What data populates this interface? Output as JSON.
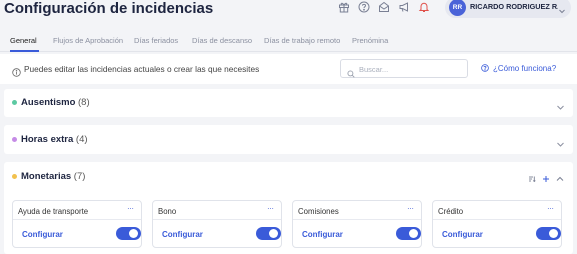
{
  "header": {
    "title": "Configuración de incidencias",
    "icons": [
      "gift-icon",
      "help-circle-icon",
      "mail-icon",
      "megaphone-icon",
      "bell-icon"
    ],
    "user": {
      "initials": "RR",
      "name": "RICARDO RODRIGUEZ R..."
    }
  },
  "tabs": [
    {
      "label": "General",
      "active": true
    },
    {
      "label": "Flujos de Aprobación",
      "active": false
    },
    {
      "label": "Días feriados",
      "active": false
    },
    {
      "label": "Días de descanso",
      "active": false
    },
    {
      "label": "Días de trabajo remoto",
      "active": false
    },
    {
      "label": "Prenómina",
      "active": false
    }
  ],
  "infobar": {
    "text": "Puedes editar las incidencias actuales o crear las que necesites",
    "search_placeholder": "Buscar...",
    "help_link": "¿Cómo funciona?"
  },
  "sections": [
    {
      "title": "Ausentismo",
      "count": "(8)",
      "color": "#5cc9a2",
      "expanded": false
    },
    {
      "title": "Horas extra",
      "count": "(4)",
      "color": "#c58be6",
      "expanded": false
    },
    {
      "title": "Monetarias",
      "count": "(7)",
      "color": "#f2c14e",
      "expanded": true
    }
  ],
  "cards": [
    {
      "title": "Ayuda de transporte",
      "menu": "···",
      "link": "Configurar",
      "enabled": true
    },
    {
      "title": "Bono",
      "menu": "···",
      "link": "Configurar",
      "enabled": true
    },
    {
      "title": "Comisiones",
      "menu": "···",
      "link": "Configurar",
      "enabled": true
    },
    {
      "title": "Crédito",
      "menu": "···",
      "link": "Configurar",
      "enabled": true
    }
  ],
  "colors": {
    "accent": "#3a5bd9",
    "background": "#f3f4f7"
  }
}
